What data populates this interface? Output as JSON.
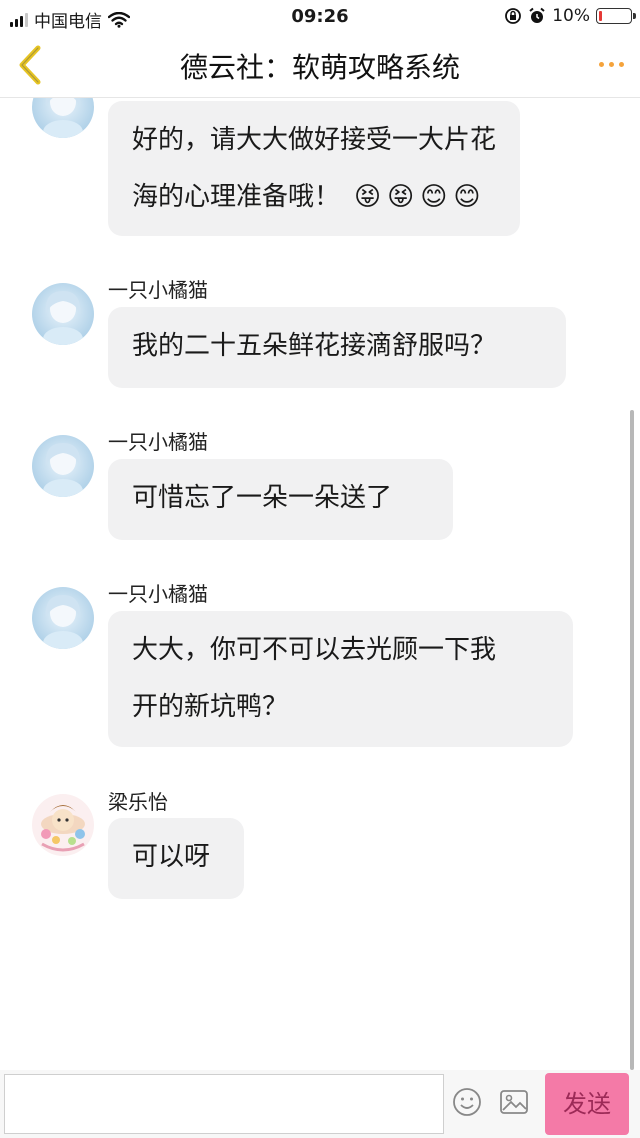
{
  "status_bar": {
    "carrier": "中国电信",
    "time": "09:26",
    "battery": "10%",
    "battery_level": 0.1
  },
  "header": {
    "title": "德云社：软萌攻略系统"
  },
  "messages": [
    {
      "sender": "",
      "avatar": "avatar-anime-girl-blue",
      "lines": [
        "好的，请大大做好接受一大片花",
        "海的心理准备哦！"
      ],
      "emojis": [
        "😝",
        "😝",
        "😊",
        "😊"
      ]
    },
    {
      "sender": "一只小橘猫",
      "avatar": "avatar-anime-girl-blue",
      "lines": [
        "我的二十五朵鲜花接滴舒服吗？"
      ]
    },
    {
      "sender": "一只小橘猫",
      "avatar": "avatar-anime-girl-blue",
      "lines": [
        "可惜忘了一朵一朵送了"
      ]
    },
    {
      "sender": "一只小橘猫",
      "avatar": "avatar-anime-girl-blue",
      "lines": [
        "大大，你可不可以去光顾一下我",
        "开的新坑鸭？"
      ]
    },
    {
      "sender": "梁乐怡",
      "avatar": "avatar-cartoon-colorful",
      "lines": [
        "可以呀"
      ]
    }
  ],
  "input_bar": {
    "message_value": "",
    "send_label": "发送"
  },
  "colors": {
    "accent": "#f5a33b",
    "send_button": "#f47aa7",
    "bubble": "#f1f1f2"
  }
}
